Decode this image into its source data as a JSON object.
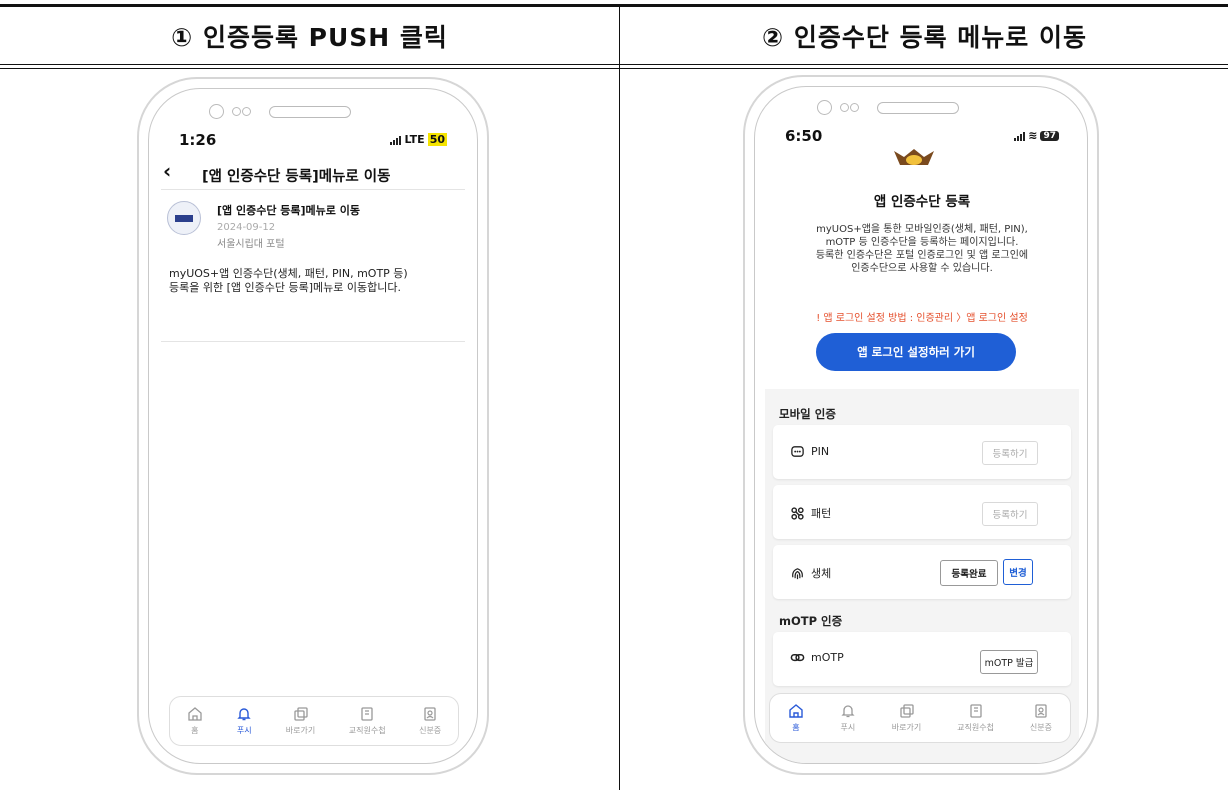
{
  "headers": {
    "left": "① 인증등록 PUSH 클릭",
    "right": "② 인증수단 등록 메뉴로 이동"
  },
  "left_phone": {
    "time": "1:26",
    "network": "LTE",
    "battery": "50",
    "nav_title": "[앱 인증수단 등록]메뉴로 이동",
    "message": {
      "title": "[앱 인증수단 등록]메뉴로 이동",
      "date": "2024-09-12",
      "source": "서울시립대 포털",
      "body_line1": "myUOS+앱 인증수단(생체, 패턴, PIN, mOTP 등)",
      "body_line2": "등록을 위한 [앱 인증수단 등록]메뉴로 이동합니다."
    },
    "tabs": [
      {
        "label": "홈",
        "icon": "home-icon"
      },
      {
        "label": "푸시",
        "icon": "bell-icon"
      },
      {
        "label": "바로가기",
        "icon": "shortcut-icon"
      },
      {
        "label": "교직원수첩",
        "icon": "notebook-icon"
      },
      {
        "label": "신분증",
        "icon": "id-card-icon"
      }
    ],
    "active_tab": 1
  },
  "right_phone": {
    "time": "6:50",
    "battery": "97",
    "page_title": "앱 인증수단 등록",
    "description_lines": [
      "myUOS+앱을 통한 모바일인증(생체, 패턴, PIN),",
      "mOTP 등 인증수단을 등록하는 페이지입니다.",
      "등록한 인증수단은 포털 인증로그인 및 앱 로그인에",
      "인증수단으로 사용할 수 있습니다."
    ],
    "warning": "!  앱 로그인 설정 방법 : 인증관리 〉앱 로그인 설정",
    "cta_button": "앱 로그인 설정하러 가기",
    "mobile_section": "모바일 인증",
    "methods": [
      {
        "label": "PIN",
        "icon": "pin-dots-icon",
        "action": "등록하기"
      },
      {
        "label": "패턴",
        "icon": "pattern-icon",
        "action": "등록하기"
      },
      {
        "label": "생체",
        "icon": "fingerprint-icon",
        "action": "등록완료",
        "action2": "변경"
      }
    ],
    "motp_section": "mOTP 인증",
    "motp": {
      "label": "mOTP",
      "icon": "link-icon",
      "action": "mOTP 발급"
    },
    "tabs": [
      {
        "label": "홈",
        "icon": "home-icon"
      },
      {
        "label": "푸시",
        "icon": "bell-icon"
      },
      {
        "label": "바로가기",
        "icon": "shortcut-icon"
      },
      {
        "label": "교직원수첩",
        "icon": "notebook-icon"
      },
      {
        "label": "신분증",
        "icon": "id-card-icon"
      }
    ],
    "active_tab": 0,
    "colors": {
      "accent": "#1f5fd6",
      "warning": "#e5502d",
      "active_tab": "#2a5ad8"
    }
  }
}
